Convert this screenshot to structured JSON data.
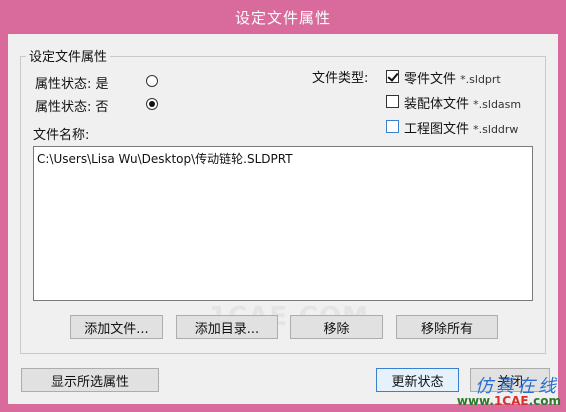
{
  "window": {
    "title": "设定文件属性"
  },
  "group": {
    "title": "设定文件属性"
  },
  "attribute_state": {
    "yes_label": "属性状态: 是",
    "no_label": "属性状态: 否",
    "selected": "no"
  },
  "file_type": {
    "label": "文件类型:",
    "options": [
      {
        "label": "零件文件",
        "ext": "*.sldprt",
        "checked": true
      },
      {
        "label": "装配体文件",
        "ext": "*.sldasm",
        "checked": false
      },
      {
        "label": "工程图文件",
        "ext": "*.slddrw",
        "checked": false
      }
    ]
  },
  "file_names": {
    "label": "文件名称:",
    "items": [
      "C:\\Users\\Lisa Wu\\Desktop\\传动链轮.SLDPRT"
    ]
  },
  "buttons": {
    "add_files": "添加文件...",
    "add_directory": "添加目录...",
    "remove": "移除",
    "remove_all": "移除所有",
    "show_selected": "显示所选属性",
    "update_status": "更新状态",
    "close": "关闭"
  },
  "watermark": "1CAE.COM",
  "logo": {
    "top": "仿真在线",
    "www": "www.",
    "brand": "1CAE",
    "com": ".com"
  },
  "colors": {
    "title_bar": "#d86a9c",
    "default_button_border": "#3a7fd0",
    "logo_blue": "#2a6fd0",
    "logo_red": "#d83030"
  }
}
